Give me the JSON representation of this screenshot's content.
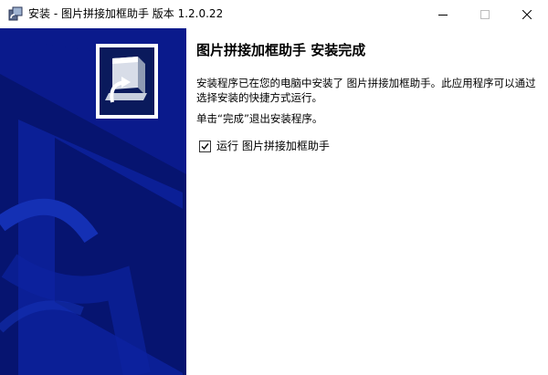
{
  "window": {
    "title": "安装 - 图片拼接加框助手 版本 1.2.0.22",
    "controls": {
      "minimize": "minimize-icon",
      "maximize": "maximize-icon",
      "close": "close-icon"
    }
  },
  "wizard": {
    "heading": "图片拼接加框助手 安装完成",
    "paragraph1": "安装程序已在您的电脑中安装了 图片拼接加框助手。此应用程序可以通过选择安装的快捷方式运行。",
    "paragraph2": "单击“完成”退出安装程序。",
    "run_checkbox": {
      "label": "运行 图片拼接加框助手",
      "checked": true
    }
  },
  "colors": {
    "sidebar_blue": "#0a1a8c",
    "sidebar_dark": "#061470",
    "sidebar_light": "#1430b4"
  }
}
